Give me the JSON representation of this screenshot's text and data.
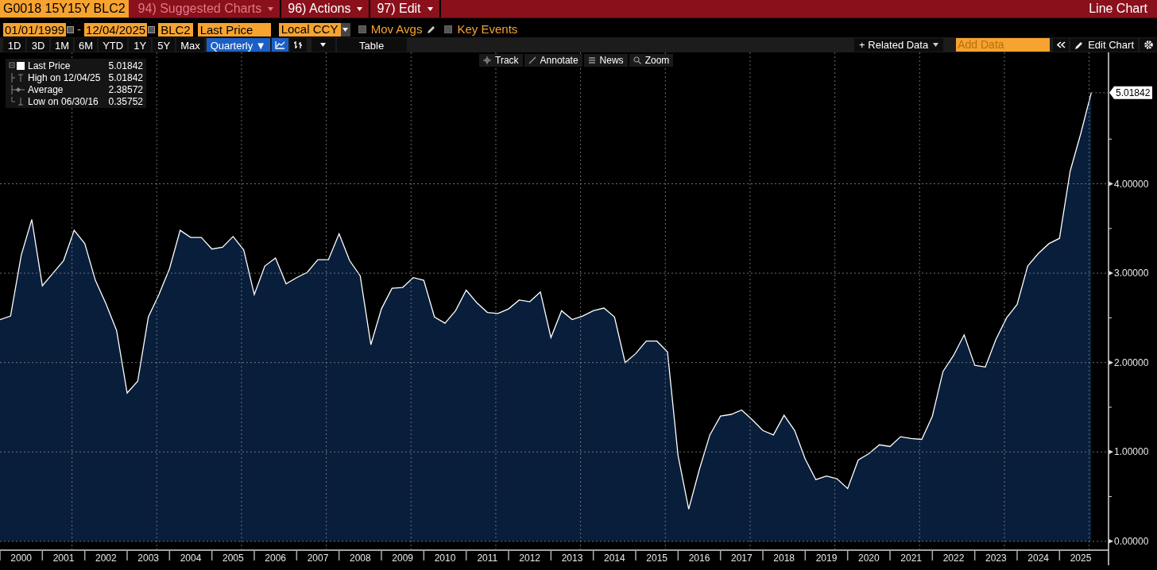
{
  "title_bar": {
    "security": "G0018 15Y15Y BLC2",
    "menus": [
      {
        "label": "94) Suggested Charts",
        "disabled": true
      },
      {
        "label": "96) Actions",
        "disabled": false
      },
      {
        "label": "97) Edit",
        "disabled": false
      }
    ],
    "chart_name": "Line Chart"
  },
  "settings_bar": {
    "start_date": "01/01/1999",
    "dash": "-",
    "end_date": "12/04/2025",
    "source": "BLC2",
    "field": "Last Price",
    "currency": "Local CCY",
    "toggles": [
      {
        "label": "Mov Avgs",
        "checked": false
      },
      {
        "label": "Key Events",
        "checked": false
      }
    ]
  },
  "toolbar": {
    "periods": [
      "1D",
      "3D",
      "1M",
      "6M",
      "YTD",
      "1Y",
      "5Y",
      "Max"
    ],
    "frequency": "Quarterly ▼",
    "chart_types": [
      {
        "kind": "line",
        "selected": true
      },
      {
        "kind": "bar",
        "selected": false
      }
    ],
    "table": "Table",
    "related_data": "+ Related Data",
    "add_data_placeholder": "Add Data",
    "edit_chart": "Edit Chart"
  },
  "chart_tools": [
    "Track",
    "Annotate",
    "News",
    "Zoom"
  ],
  "legend": [
    {
      "kind": "last",
      "value": "5.01842"
    },
    {
      "kind": "high",
      "label": "High on 12/04/25",
      "value": "5.01842"
    },
    {
      "kind": "average",
      "label": "Average",
      "value": "2.38572"
    },
    {
      "kind": "low",
      "label": "Low on 06/30/16",
      "value": "0.35752"
    }
  ],
  "chart": {
    "chart_data": {
      "type": "area",
      "x": [
        2000,
        2000.25,
        2000.5,
        2000.75,
        2001,
        2001.25,
        2001.5,
        2001.75,
        2002,
        2002.25,
        2002.5,
        2002.75,
        2003,
        2003.25,
        2003.5,
        2003.75,
        2004,
        2004.25,
        2004.5,
        2004.75,
        2005,
        2005.25,
        2005.5,
        2005.75,
        2006,
        2006.25,
        2006.5,
        2006.75,
        2007,
        2007.25,
        2007.5,
        2007.75,
        2008,
        2008.25,
        2008.5,
        2008.75,
        2009,
        2009.25,
        2009.5,
        2009.75,
        2010,
        2010.25,
        2010.5,
        2010.75,
        2011,
        2011.25,
        2011.5,
        2011.75,
        2012,
        2012.25,
        2012.5,
        2012.75,
        2013,
        2013.25,
        2013.5,
        2013.75,
        2014,
        2014.25,
        2014.5,
        2014.75,
        2015,
        2015.25,
        2015.5,
        2015.75,
        2016,
        2016.25,
        2016.5,
        2016.75,
        2017,
        2017.25,
        2017.5,
        2017.75,
        2018,
        2018.25,
        2018.5,
        2018.75,
        2019,
        2019.25,
        2019.5,
        2019.75,
        2020,
        2020.25,
        2020.5,
        2020.75,
        2021,
        2021.25,
        2021.5,
        2021.75,
        2022,
        2022.25,
        2022.5,
        2022.75,
        2023,
        2023.25,
        2023.5,
        2023.75,
        2024,
        2024.25,
        2024.5,
        2024.75,
        2025,
        2025.25,
        2025.5,
        2025.75
      ],
      "series": [
        {
          "name": "Last Price",
          "color": "#ffffff",
          "values": [
            2.48,
            2.52,
            3.2,
            3.6,
            2.86,
            3.0,
            3.14,
            3.48,
            3.33,
            2.92,
            2.66,
            2.36,
            1.66,
            1.79,
            2.51,
            2.76,
            3.05,
            3.48,
            3.4,
            3.4,
            3.27,
            3.29,
            3.41,
            3.26,
            2.76,
            3.08,
            3.17,
            2.88,
            2.95,
            3.01,
            3.15,
            3.15,
            3.44,
            3.14,
            2.97,
            2.2,
            2.6,
            2.83,
            2.84,
            2.95,
            2.92,
            2.51,
            2.44,
            2.58,
            2.81,
            2.67,
            2.56,
            2.55,
            2.6,
            2.7,
            2.68,
            2.79,
            2.28,
            2.58,
            2.48,
            2.52,
            2.58,
            2.61,
            2.51,
            2.0,
            2.1,
            2.24,
            2.24,
            2.12,
            0.96,
            0.36,
            0.8,
            1.19,
            1.4,
            1.42,
            1.47,
            1.36,
            1.24,
            1.19,
            1.41,
            1.24,
            0.92,
            0.69,
            0.73,
            0.7,
            0.59,
            0.91,
            0.98,
            1.08,
            1.06,
            1.17,
            1.15,
            1.14,
            1.4,
            1.9,
            2.08,
            2.31,
            1.97,
            1.95,
            2.26,
            2.5,
            2.65,
            3.08,
            3.22,
            3.33,
            3.39,
            4.14,
            4.56,
            5.02
          ]
        }
      ],
      "xlim": [
        2000,
        2026.1
      ],
      "ylim": [
        -0.09,
        5.47
      ],
      "grid": true,
      "xticks": [
        {
          "value": 2000.5,
          "label": "2000"
        },
        {
          "value": 2001.5,
          "label": "2001"
        },
        {
          "value": 2002.5,
          "label": "2002"
        },
        {
          "value": 2003.5,
          "label": "2003"
        },
        {
          "value": 2004.5,
          "label": "2004"
        },
        {
          "value": 2005.5,
          "label": "2005"
        },
        {
          "value": 2006.5,
          "label": "2006"
        },
        {
          "value": 2007.5,
          "label": "2007"
        },
        {
          "value": 2008.5,
          "label": "2008"
        },
        {
          "value": 2009.5,
          "label": "2009"
        },
        {
          "value": 2010.5,
          "label": "2010"
        },
        {
          "value": 2011.5,
          "label": "2011"
        },
        {
          "value": 2012.5,
          "label": "2012"
        },
        {
          "value": 2013.5,
          "label": "2013"
        },
        {
          "value": 2014.5,
          "label": "2014"
        },
        {
          "value": 2015.5,
          "label": "2015"
        },
        {
          "value": 2016.5,
          "label": "2016"
        },
        {
          "value": 2017.5,
          "label": "2017"
        },
        {
          "value": 2018.5,
          "label": "2018"
        },
        {
          "value": 2019.5,
          "label": "2019"
        },
        {
          "value": 2020.5,
          "label": "2020"
        },
        {
          "value": 2021.5,
          "label": "2021"
        },
        {
          "value": 2022.5,
          "label": "2022"
        },
        {
          "value": 2023.5,
          "label": "2023"
        },
        {
          "value": 2024.5,
          "label": "2024"
        },
        {
          "value": 2025.5,
          "label": "2025"
        }
      ],
      "yticks": [
        {
          "value": 0,
          "label": "0.00000"
        },
        {
          "value": 1,
          "label": "1.00000"
        },
        {
          "value": 2,
          "label": "2.00000"
        },
        {
          "value": 3,
          "label": "3.00000"
        },
        {
          "value": 4,
          "label": "4.00000"
        }
      ],
      "annotations": [
        {
          "x": 2025.75,
          "y": 5.01842,
          "text": "5.01842"
        }
      ]
    }
  }
}
